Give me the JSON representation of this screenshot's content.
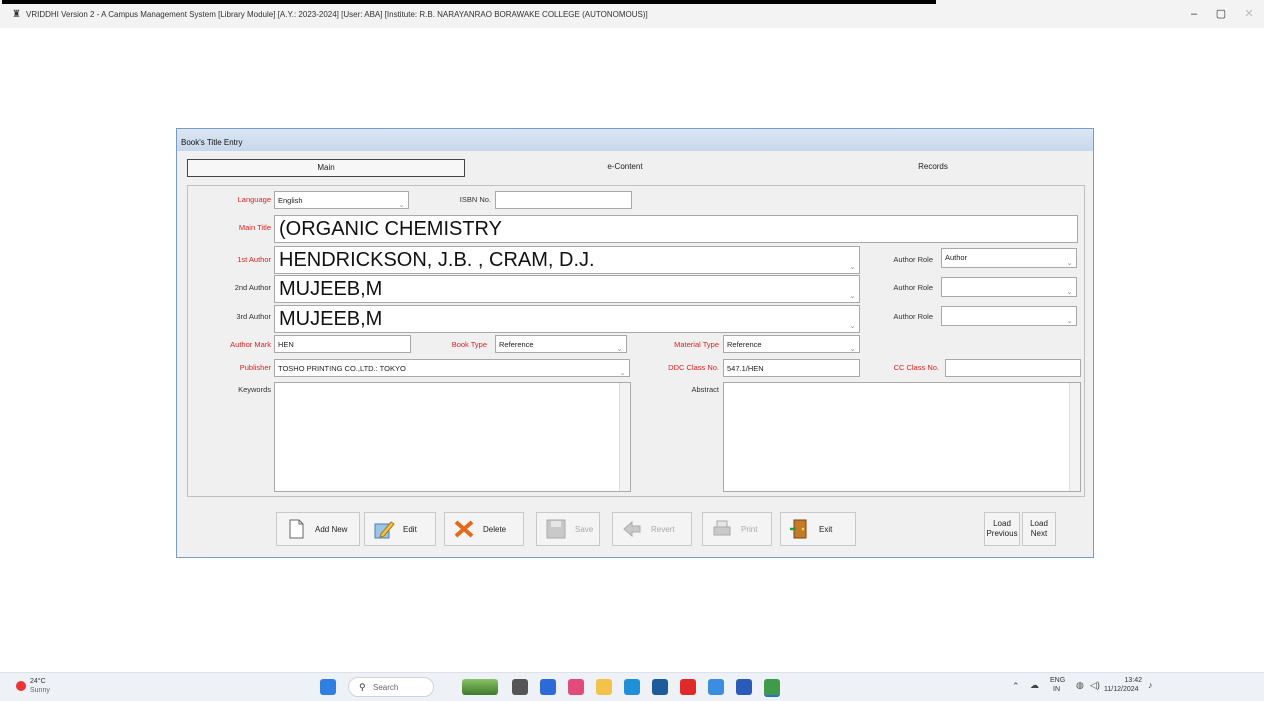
{
  "app": {
    "title": "VRIDDHI Version 2 - A Campus Management System [Library Module] [A.Y.: 2023-2024] [User: ABA] [Institute: R.B. NARAYANRAO BORAWAKE COLLEGE (AUTONOMOUS)]",
    "minimize": "–",
    "maximize": "▢",
    "close": "✕"
  },
  "form": {
    "title": "Book's Title Entry",
    "tabs": [
      "Main",
      "e-Content",
      "Records"
    ],
    "labels": {
      "language": "Language",
      "isbn": "ISBN No.",
      "main_title": "Main Title",
      "author1": "1st Author",
      "author2": "2nd Author",
      "author3": "3rd Author",
      "author_role": "Author Role",
      "author_mark": "Author Mark",
      "book_type": "Book Type",
      "material_type": "Material Type",
      "publisher": "Publisher",
      "ddc": "DDC Class No.",
      "cc": "CC Class No.",
      "keywords": "Keywords",
      "abstract": "Abstract"
    },
    "values": {
      "language": "English",
      "isbn": "",
      "main_title": "(ORGANIC CHEMISTRY",
      "author1": "HENDRICKSON, J.B. , CRAM, D.J.",
      "author1_role": "Author",
      "author2": "MUJEEB,M",
      "author2_role": "",
      "author3": "MUJEEB,M",
      "author3_role": "",
      "author_mark": "HEN",
      "book_type": "Reference",
      "material_type": "Reference",
      "publisher": "TOSHO PRINTING CO.,LTD.: TOKYO",
      "ddc": "547.1/HEN",
      "cc": "",
      "keywords": "",
      "abstract": ""
    },
    "buttons": {
      "add_new": "Add New",
      "edit": "Edit",
      "delete": "Delete",
      "save": "Save",
      "revert": "Revert",
      "print": "Print",
      "exit": "Exit",
      "load_previous_1": "Load",
      "load_previous_2": "Previous",
      "load_next_1": "Load",
      "load_next_2": "Next"
    }
  },
  "taskbar": {
    "weather_temp": "24°C",
    "weather_text": "Sunny",
    "search_placeholder": "Search",
    "lang1": "ENG",
    "lang2": "IN",
    "time": "13:42",
    "date": "11/12/2024"
  },
  "colors": {
    "required_label": "#d22222",
    "window_border": "#7a9cc4"
  }
}
